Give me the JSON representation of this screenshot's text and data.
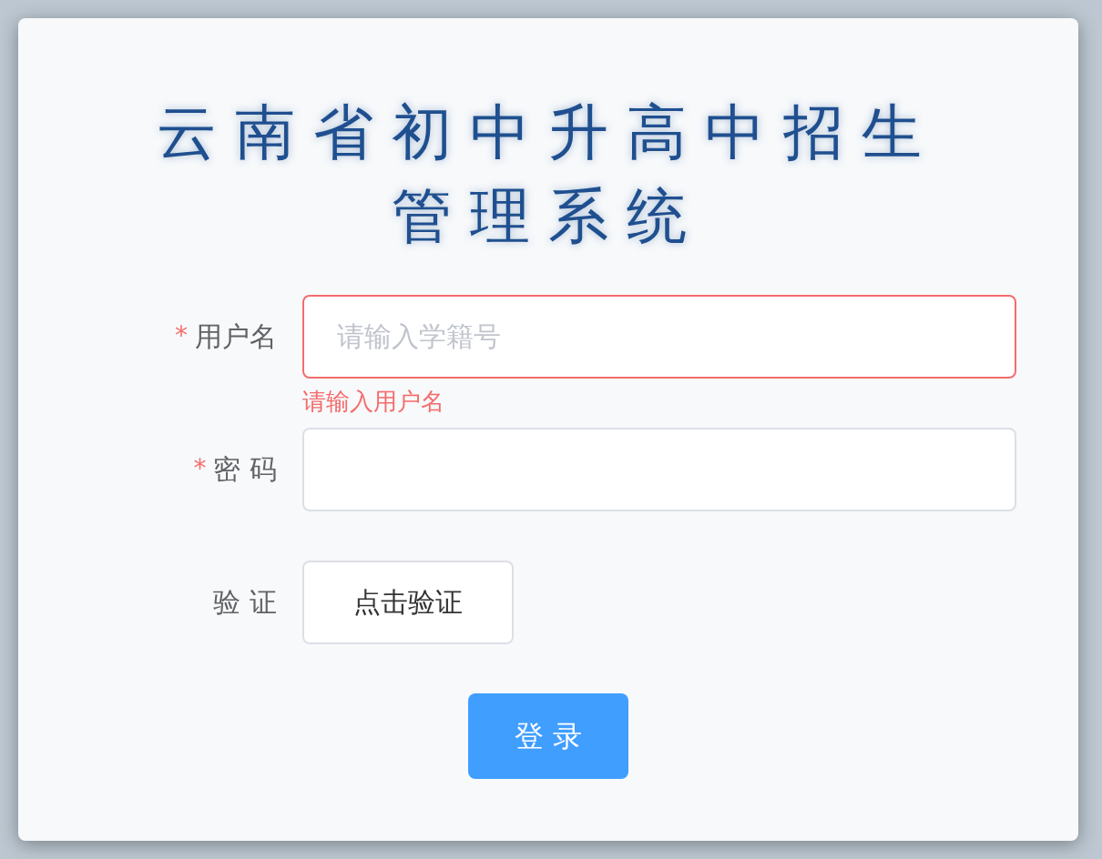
{
  "title": [
    "云南省初中升高中招生",
    "管理系统"
  ],
  "fields": [
    {
      "kind": "input",
      "label": "用户名",
      "required_mark": "*",
      "placeholder": "请输入学籍号",
      "error": "请输入用户名"
    },
    {
      "kind": "input",
      "label": "密 码",
      "required_mark": "*"
    },
    {
      "kind": "captcha",
      "label": "验 证",
      "button": "点击验证"
    }
  ],
  "login_button": "登 录"
}
